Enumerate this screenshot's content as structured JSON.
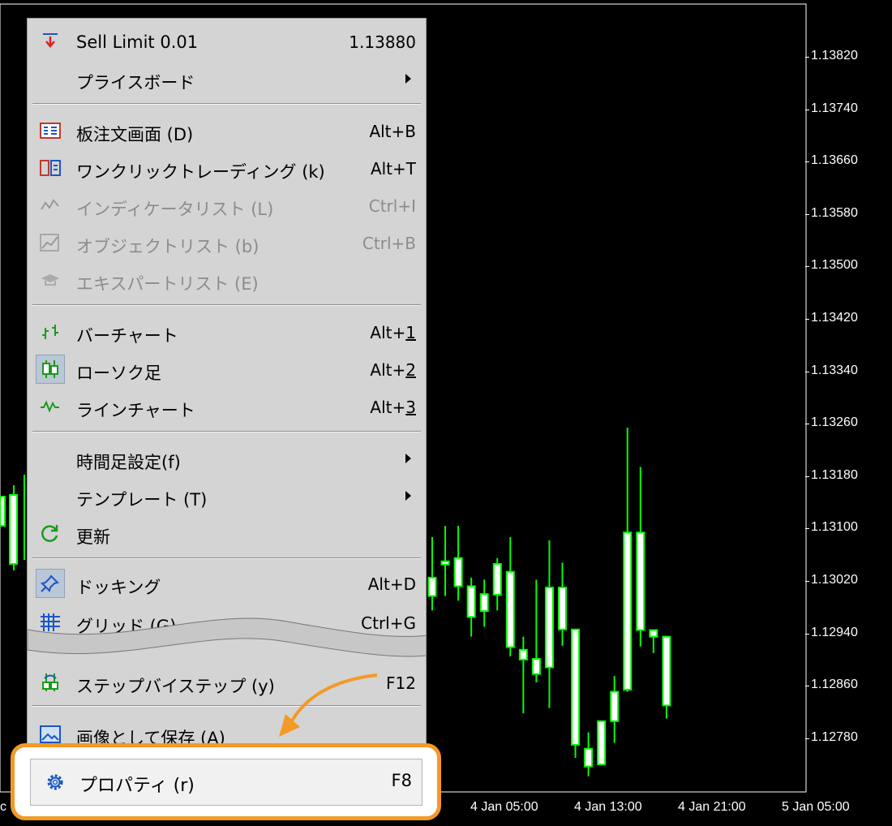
{
  "menu": {
    "items": [
      {
        "label": "Sell Limit 0.01",
        "shortcut": "1.13880",
        "icon": "sell-limit-icon",
        "disabled": false
      },
      {
        "label": "プライスボード",
        "shortcut": "",
        "icon": "",
        "submenu": true
      },
      {
        "label": "板注文画面 (D)",
        "shortcut": "Alt+B",
        "icon": "depth-of-market-icon"
      },
      {
        "label": "ワンクリックトレーディング (k)",
        "shortcut": "Alt+T",
        "icon": "one-click-trading-icon"
      },
      {
        "label": "インディケータリスト (L)",
        "shortcut": "Ctrl+I",
        "icon": "indicator-list-icon",
        "disabled": true
      },
      {
        "label": "オブジェクトリスト (b)",
        "shortcut": "Ctrl+B",
        "icon": "object-list-icon",
        "disabled": true
      },
      {
        "label": "エキスパートリスト (E)",
        "shortcut": "",
        "icon": "expert-list-icon",
        "disabled": true
      },
      {
        "label": "バーチャート",
        "shortcut_prefix": "Alt+",
        "shortcut_key": "1",
        "icon": "bar-chart-icon"
      },
      {
        "label": "ローソク足",
        "shortcut_prefix": "Alt+",
        "shortcut_key": "2",
        "icon": "candlestick-icon"
      },
      {
        "label": "ラインチャート",
        "shortcut_prefix": "Alt+",
        "shortcut_key": "3",
        "icon": "line-chart-icon"
      },
      {
        "label": "時間足設定(f)",
        "shortcut": "",
        "submenu": true
      },
      {
        "label": "テンプレート (T)",
        "shortcut": "",
        "submenu": true
      },
      {
        "label": "更新",
        "shortcut": "",
        "icon": "refresh-icon"
      },
      {
        "label": "ドッキング",
        "shortcut": "Alt+D",
        "icon": "pin-icon"
      },
      {
        "label": "グリッド (G)",
        "shortcut": "Ctrl+G",
        "icon": "grid-icon"
      },
      {
        "label": "ステップバイステップ (y)",
        "shortcut": "F12",
        "icon": "step-icon"
      },
      {
        "label": "画像として保存 (A)",
        "shortcut": "",
        "icon": "save-image-icon"
      }
    ],
    "properties": {
      "label": "プロパティ (r)",
      "shortcut": "F8",
      "icon": "gear-icon"
    }
  },
  "chart": {
    "price_labels": [
      "1.13820",
      "1.13740",
      "1.13660",
      "1.13580",
      "1.13500",
      "1.13420",
      "1.13340",
      "1.13260",
      "1.13180",
      "1.13100",
      "1.13020",
      "1.12940",
      "1.12860",
      "1.12780"
    ],
    "time_labels": [
      "c",
      "4 Jan 05:00",
      "4 Jan 13:00",
      "4 Jan 21:00",
      "5 Jan 05:00"
    ]
  },
  "colors": {
    "up": "#00ff00",
    "candle_body": "#ffffff",
    "callout": "#f29a25",
    "background": "#000000"
  },
  "chart_data": {
    "type": "candlestick",
    "candles": [
      {
        "o": 1.12997,
        "h": 1.13087,
        "l": 1.12975,
        "c": 1.13025
      },
      {
        "o": 1.1305,
        "h": 1.13104,
        "l": 1.12997,
        "c": 1.13046
      },
      {
        "o": 1.13055,
        "h": 1.13104,
        "l": 1.1299,
        "c": 1.13012
      },
      {
        "o": 1.13012,
        "h": 1.13025,
        "l": 1.12935,
        "c": 1.12965
      },
      {
        "o": 1.12974,
        "h": 1.13022,
        "l": 1.1295,
        "c": 1.13
      },
      {
        "o": 1.13046,
        "h": 1.13055,
        "l": 1.12975,
        "c": 1.12999
      },
      {
        "o": 1.13034,
        "h": 1.13087,
        "l": 1.12905,
        "c": 1.12919
      },
      {
        "o": 1.12915,
        "h": 1.12935,
        "l": 1.12818,
        "c": 1.129
      },
      {
        "o": 1.12901,
        "h": 1.13022,
        "l": 1.12865,
        "c": 1.12878
      },
      {
        "o": 1.12888,
        "h": 1.13082,
        "l": 1.12826,
        "c": 1.1301
      },
      {
        "o": 1.1301,
        "h": 1.13048,
        "l": 1.12921,
        "c": 1.12946
      },
      {
        "o": 1.12946,
        "h": 1.12946,
        "l": 1.1275,
        "c": 1.1277
      },
      {
        "o": 1.12764,
        "h": 1.12789,
        "l": 1.12722,
        "c": 1.12737
      },
      {
        "o": 1.1274,
        "h": 1.12806,
        "l": 1.1274,
        "c": 1.12806
      },
      {
        "o": 1.12806,
        "h": 1.12875,
        "l": 1.12773,
        "c": 1.12851
      },
      {
        "o": 1.12854,
        "h": 1.13254,
        "l": 1.12851,
        "c": 1.13094
      },
      {
        "o": 1.13094,
        "h": 1.13194,
        "l": 1.1292,
        "c": 1.12945
      },
      {
        "o": 1.12945,
        "h": 1.12875,
        "l": 1.1291,
        "c": 1.12935
      },
      {
        "o": 1.12935,
        "h": 1.12925,
        "l": 1.1281,
        "c": 1.1283
      }
    ]
  }
}
